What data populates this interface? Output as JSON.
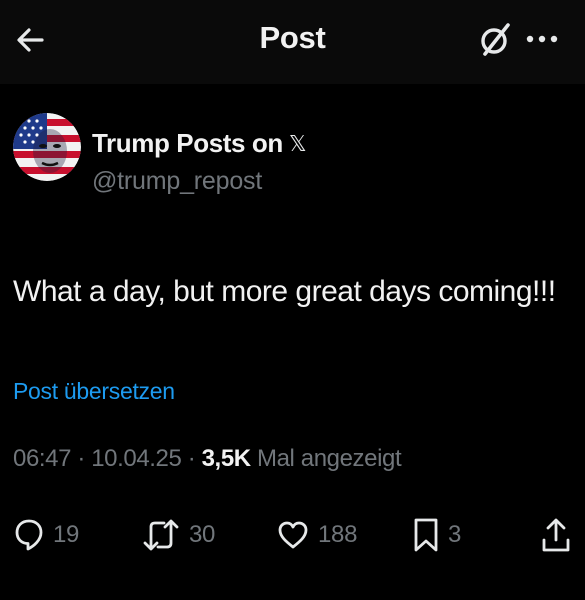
{
  "header": {
    "title": "Post",
    "back_icon": "arrow-left-icon",
    "grok_icon": "grok-icon",
    "more_icon": "more-horizontal-icon"
  },
  "author": {
    "display_name": "Trump Posts on",
    "platform_logo": "𝕏",
    "handle": "@trump_repost",
    "avatar_icon": "flag-face-avatar"
  },
  "post": {
    "text": "What a day, but more great days coming!!!",
    "translate_label": "Post übersetzen",
    "time": "06:47",
    "date": "10.04.25",
    "separator": "·",
    "views_count": "3,5K",
    "views_label": "Mal angezeigt"
  },
  "actions": {
    "replies": "19",
    "reposts": "30",
    "likes": "188",
    "bookmarks": "3"
  },
  "colors": {
    "background": "#000000",
    "accent": "#1d9bf0",
    "secondary_text": "#71767b",
    "primary_text": "#e7e9ea"
  }
}
